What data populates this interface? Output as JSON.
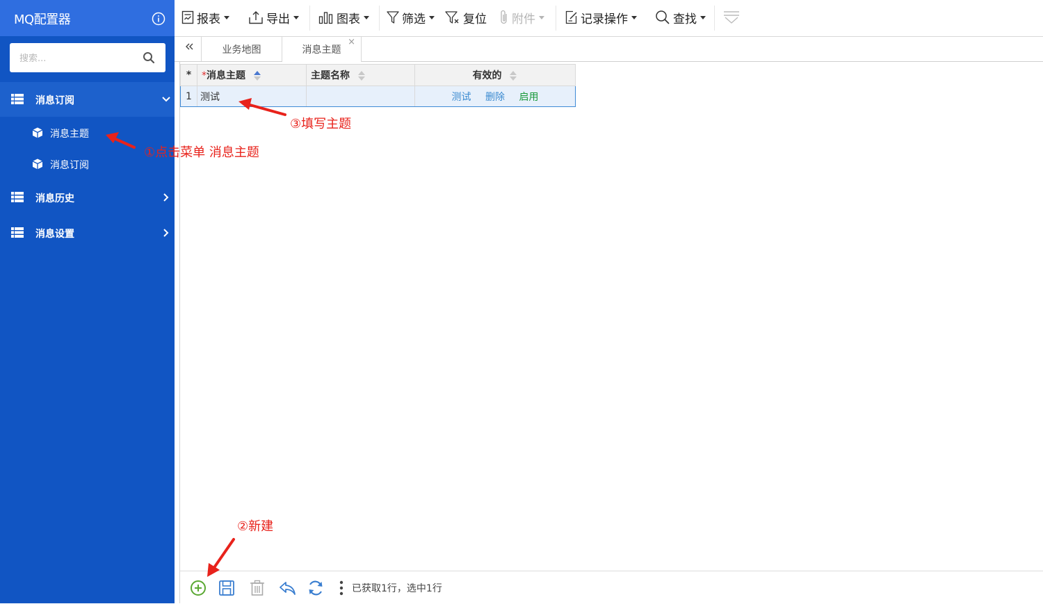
{
  "app": {
    "title": "MQ配置器"
  },
  "sidebar": {
    "search_placeholder": "搜索...",
    "groups": [
      {
        "label": "消息订阅",
        "expanded": true,
        "items": [
          {
            "label": "消息主题"
          },
          {
            "label": "消息订阅"
          }
        ]
      },
      {
        "label": "消息历史",
        "expanded": false
      },
      {
        "label": "消息设置",
        "expanded": false
      }
    ]
  },
  "toolbar": {
    "report": "报表",
    "export": "导出",
    "chart": "图表",
    "filter": "筛选",
    "reset": "复位",
    "attachment": "附件",
    "record_ops": "记录操作",
    "find": "查找"
  },
  "tabs": {
    "items": [
      {
        "label": "业务地图"
      },
      {
        "label": "消息主题"
      }
    ],
    "close_glyph": "×"
  },
  "grid": {
    "row_marker_header": "*",
    "required_mark": "*",
    "columns": [
      "消息主题",
      "主题名称",
      "有效的"
    ],
    "rows": [
      {
        "index": "1",
        "topic": "测试",
        "name": "",
        "actions": [
          "测试",
          "删除",
          "启用"
        ]
      }
    ]
  },
  "footer": {
    "status": "已获取1行，选中1行"
  },
  "annotations": {
    "step1": "①点击菜单 消息主题",
    "step2": "②新建",
    "step3": "③填写主题"
  },
  "colors": {
    "sidebar_bg": "#1155c3",
    "header_bg": "#2f6ee0",
    "annotation": "#e8221b",
    "link": "#3a8ad0",
    "enable_link": "#1a9a3a"
  }
}
